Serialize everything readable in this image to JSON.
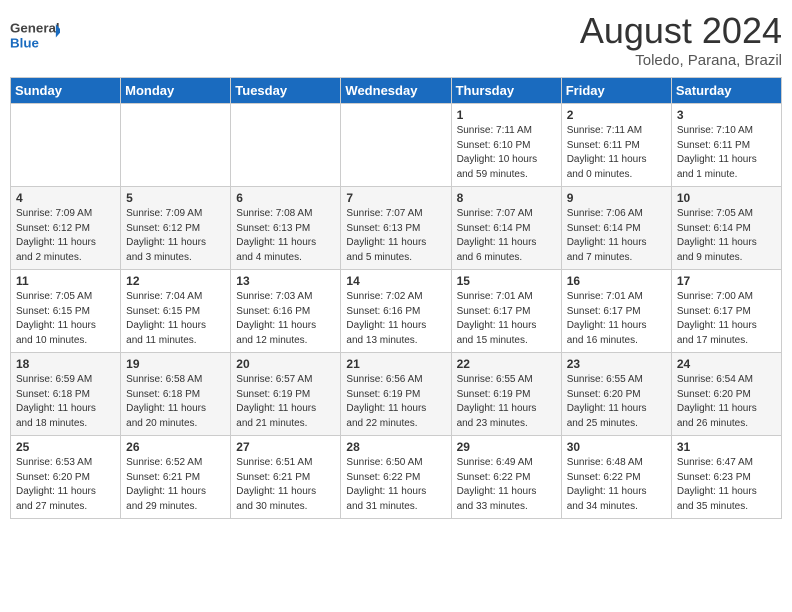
{
  "header": {
    "logo_general": "General",
    "logo_blue": "Blue",
    "month_year": "August 2024",
    "location": "Toledo, Parana, Brazil"
  },
  "days_of_week": [
    "Sunday",
    "Monday",
    "Tuesday",
    "Wednesday",
    "Thursday",
    "Friday",
    "Saturday"
  ],
  "weeks": [
    [
      {
        "day": "",
        "info": ""
      },
      {
        "day": "",
        "info": ""
      },
      {
        "day": "",
        "info": ""
      },
      {
        "day": "",
        "info": ""
      },
      {
        "day": "1",
        "info": "Sunrise: 7:11 AM\nSunset: 6:10 PM\nDaylight: 10 hours\nand 59 minutes."
      },
      {
        "day": "2",
        "info": "Sunrise: 7:11 AM\nSunset: 6:11 PM\nDaylight: 11 hours\nand 0 minutes."
      },
      {
        "day": "3",
        "info": "Sunrise: 7:10 AM\nSunset: 6:11 PM\nDaylight: 11 hours\nand 1 minute."
      }
    ],
    [
      {
        "day": "4",
        "info": "Sunrise: 7:09 AM\nSunset: 6:12 PM\nDaylight: 11 hours\nand 2 minutes."
      },
      {
        "day": "5",
        "info": "Sunrise: 7:09 AM\nSunset: 6:12 PM\nDaylight: 11 hours\nand 3 minutes."
      },
      {
        "day": "6",
        "info": "Sunrise: 7:08 AM\nSunset: 6:13 PM\nDaylight: 11 hours\nand 4 minutes."
      },
      {
        "day": "7",
        "info": "Sunrise: 7:07 AM\nSunset: 6:13 PM\nDaylight: 11 hours\nand 5 minutes."
      },
      {
        "day": "8",
        "info": "Sunrise: 7:07 AM\nSunset: 6:14 PM\nDaylight: 11 hours\nand 6 minutes."
      },
      {
        "day": "9",
        "info": "Sunrise: 7:06 AM\nSunset: 6:14 PM\nDaylight: 11 hours\nand 7 minutes."
      },
      {
        "day": "10",
        "info": "Sunrise: 7:05 AM\nSunset: 6:14 PM\nDaylight: 11 hours\nand 9 minutes."
      }
    ],
    [
      {
        "day": "11",
        "info": "Sunrise: 7:05 AM\nSunset: 6:15 PM\nDaylight: 11 hours\nand 10 minutes."
      },
      {
        "day": "12",
        "info": "Sunrise: 7:04 AM\nSunset: 6:15 PM\nDaylight: 11 hours\nand 11 minutes."
      },
      {
        "day": "13",
        "info": "Sunrise: 7:03 AM\nSunset: 6:16 PM\nDaylight: 11 hours\nand 12 minutes."
      },
      {
        "day": "14",
        "info": "Sunrise: 7:02 AM\nSunset: 6:16 PM\nDaylight: 11 hours\nand 13 minutes."
      },
      {
        "day": "15",
        "info": "Sunrise: 7:01 AM\nSunset: 6:17 PM\nDaylight: 11 hours\nand 15 minutes."
      },
      {
        "day": "16",
        "info": "Sunrise: 7:01 AM\nSunset: 6:17 PM\nDaylight: 11 hours\nand 16 minutes."
      },
      {
        "day": "17",
        "info": "Sunrise: 7:00 AM\nSunset: 6:17 PM\nDaylight: 11 hours\nand 17 minutes."
      }
    ],
    [
      {
        "day": "18",
        "info": "Sunrise: 6:59 AM\nSunset: 6:18 PM\nDaylight: 11 hours\nand 18 minutes."
      },
      {
        "day": "19",
        "info": "Sunrise: 6:58 AM\nSunset: 6:18 PM\nDaylight: 11 hours\nand 20 minutes."
      },
      {
        "day": "20",
        "info": "Sunrise: 6:57 AM\nSunset: 6:19 PM\nDaylight: 11 hours\nand 21 minutes."
      },
      {
        "day": "21",
        "info": "Sunrise: 6:56 AM\nSunset: 6:19 PM\nDaylight: 11 hours\nand 22 minutes."
      },
      {
        "day": "22",
        "info": "Sunrise: 6:55 AM\nSunset: 6:19 PM\nDaylight: 11 hours\nand 23 minutes."
      },
      {
        "day": "23",
        "info": "Sunrise: 6:55 AM\nSunset: 6:20 PM\nDaylight: 11 hours\nand 25 minutes."
      },
      {
        "day": "24",
        "info": "Sunrise: 6:54 AM\nSunset: 6:20 PM\nDaylight: 11 hours\nand 26 minutes."
      }
    ],
    [
      {
        "day": "25",
        "info": "Sunrise: 6:53 AM\nSunset: 6:20 PM\nDaylight: 11 hours\nand 27 minutes."
      },
      {
        "day": "26",
        "info": "Sunrise: 6:52 AM\nSunset: 6:21 PM\nDaylight: 11 hours\nand 29 minutes."
      },
      {
        "day": "27",
        "info": "Sunrise: 6:51 AM\nSunset: 6:21 PM\nDaylight: 11 hours\nand 30 minutes."
      },
      {
        "day": "28",
        "info": "Sunrise: 6:50 AM\nSunset: 6:22 PM\nDaylight: 11 hours\nand 31 minutes."
      },
      {
        "day": "29",
        "info": "Sunrise: 6:49 AM\nSunset: 6:22 PM\nDaylight: 11 hours\nand 33 minutes."
      },
      {
        "day": "30",
        "info": "Sunrise: 6:48 AM\nSunset: 6:22 PM\nDaylight: 11 hours\nand 34 minutes."
      },
      {
        "day": "31",
        "info": "Sunrise: 6:47 AM\nSunset: 6:23 PM\nDaylight: 11 hours\nand 35 minutes."
      }
    ]
  ]
}
